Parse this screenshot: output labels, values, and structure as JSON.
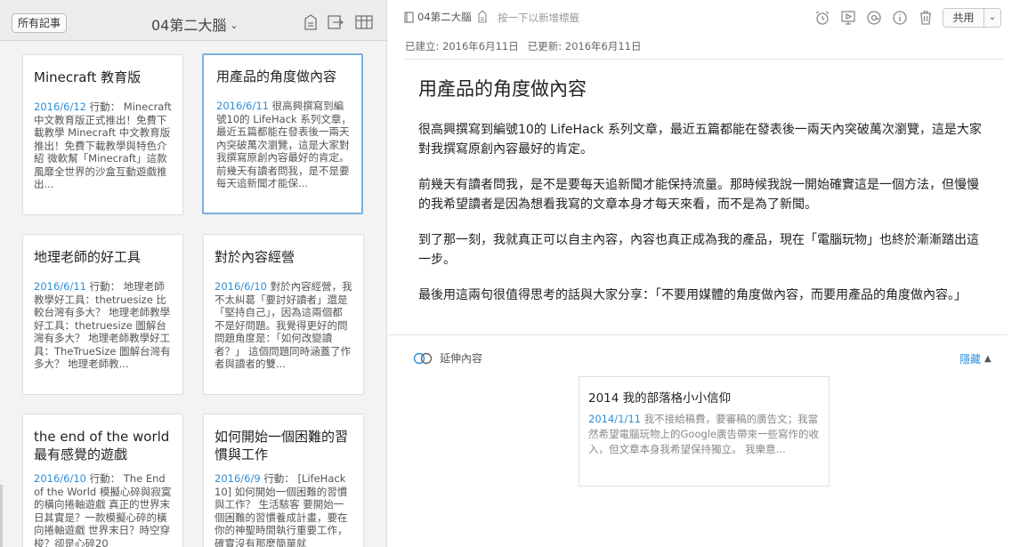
{
  "left_header": {
    "all_notes": "所有記事",
    "notebook_title": "04第二大腦"
  },
  "cards": [
    {
      "title": "Minecraft 教育版",
      "date": "2016/6/12",
      "snippet": "行動： Minecraft 中文教育版正式推出！免費下載教學 Minecraft 中文教育版推出！免費下載教學與特色介紹 微軟幫「Minecraft」這款風靡全世界的沙盒互動遊戲推出..."
    },
    {
      "title": "用產品的角度做內容",
      "date": "2016/6/11",
      "snippet": "很高興撰寫到編號10的 LifeHack 系列文章，最近五篇都能在發表後一兩天內突破萬次瀏覽，這是大家對我撰寫原創內容最好的肯定。 前幾天有讀者問我，是不是要每天追新聞才能保..."
    },
    {
      "title": "地理老師的好工具",
      "date": "2016/6/11",
      "snippet": "行動： 地理老師教學好工具：thetruesize 比較台灣有多大？ 地理老師教學好工具：thetruesize 圖解台灣有多大？ 地理老師教學好工具：TheTrueSize 圖解台灣有多大？ 地理老師教..."
    },
    {
      "title": "對於內容經營",
      "date": "2016/6/10",
      "snippet": "對於內容經營，我不太糾葛「要討好讀者」還是「堅持自己」，因為這兩個都不是好問題。我覺得更好的問問題角度是：「如何改變讀者？」 這個問題同時涵蓋了作者與讀者的雙..."
    },
    {
      "title": "the end of the world 最有感覺的遊戲",
      "date": "2016/6/10",
      "snippet": "行動： The End of the World 模擬心碎與寂寞的橫向捲軸遊戲 真正的世界末日其實是？一款模擬心碎的橫向捲軸遊戲 世界末日？時空穿梭？卻是心碎20"
    },
    {
      "title": "如何開始一個困難的習慣與工作",
      "date": "2016/6/9",
      "snippet": "行動： [LifeHack 10] 如何開始一個困難的習慣與工作？ 生活駭客 要開始一個困難的習慣養成計畫，要在你的神聖時間執行重要工作，確實沒有那麼簡單就"
    }
  ],
  "toolbar": {
    "notebook": "04第二大腦",
    "tag_placeholder": "按一下以新增標籤",
    "share": "共用"
  },
  "meta": {
    "created": "已建立: 2016年6月11日",
    "updated": "已更新: 2016年6月11日"
  },
  "note": {
    "title": "用產品的角度做內容",
    "paragraphs": [
      "很高興撰寫到編號10的 LifeHack 系列文章，最近五篇都能在發表後一兩天內突破萬次瀏覽，這是大家對我撰寫原創內容最好的肯定。",
      "前幾天有讀者問我，是不是要每天追新聞才能保持流量。那時候我說一開始確實這是一個方法，但慢慢的我希望讀者是因為想看我寫的文章本身才每天來看，而不是為了新聞。",
      "到了那一刻，我就真正可以自主內容，內容也真正成為我的產品，現在「電腦玩物」也終於漸漸踏出這一步。",
      "最後用這兩句很值得思考的話與大家分享：「不要用媒體的角度做內容，而要用產品的角度做內容。」"
    ]
  },
  "related": {
    "header": "延伸內容",
    "hide": "隱藏",
    "card": {
      "title": "2014 我的部落格小小信仰",
      "date": "2014/1/11",
      "snippet": "我不接給稿費，要審稿的廣告文；我當然希望電腦玩物上的Google廣告帶來一些寫作的收入，但文章本身我希望保持獨立。 我樂意..."
    }
  },
  "colors": {
    "accent": "#2f8fd8",
    "selected_border": "#7aafe0"
  }
}
